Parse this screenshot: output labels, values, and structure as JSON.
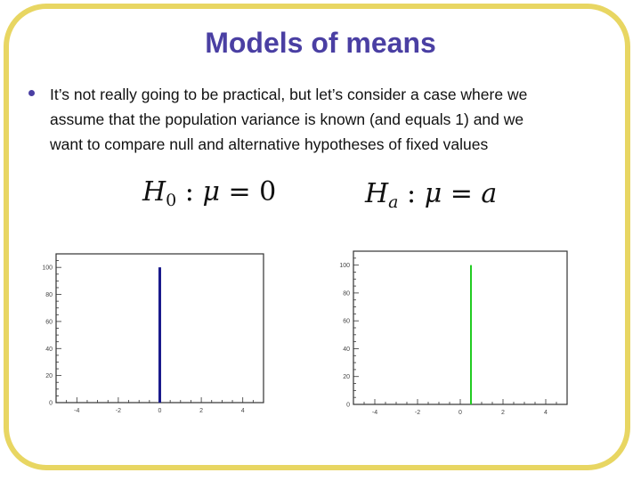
{
  "slide": {
    "title": "Models of means",
    "bullets": [
      {
        "lines": [
          "It’s not really going to be practical, but let’s consider a case where we",
          "assume that the population variance is known (and equals 1) and we",
          "want to compare null and alternative hypotheses of fixed values"
        ]
      }
    ],
    "formulas": {
      "null": {
        "H": "H",
        "sub": "0",
        "rest_mu": "μ",
        "colon": " : ",
        "equals": " = ",
        "value": "0"
      },
      "alt": {
        "H": "H",
        "sub": "a",
        "rest_mu": "μ",
        "colon": " : ",
        "equals": " = ",
        "value": "a"
      }
    },
    "colors": {
      "frame": "#e8d662",
      "title": "#4a3fa3",
      "null_line": "#1a1a8c",
      "alt_line": "#22cc22"
    }
  },
  "chart_data": [
    {
      "type": "bar",
      "name": "null-hypothesis-distribution",
      "title": "",
      "xlabel": "",
      "ylabel": "",
      "x": [
        0
      ],
      "values": [
        100
      ],
      "xlim": [
        -5,
        5
      ],
      "ylim": [
        0,
        110
      ],
      "xticks": [
        -4,
        -2,
        0,
        2,
        4
      ],
      "xtick_labels": [
        "-4",
        "-2",
        "0",
        "2",
        "4"
      ],
      "yticks": [
        0,
        20,
        40,
        60,
        80,
        100
      ],
      "ytick_labels": [
        "0",
        "20",
        "40",
        "60",
        "80",
        "100"
      ],
      "color": "#1a1a8c",
      "grid": false
    },
    {
      "type": "bar",
      "name": "alternative-hypothesis-distribution",
      "title": "",
      "xlabel": "",
      "ylabel": "",
      "x": [
        0.5
      ],
      "values": [
        100
      ],
      "xlim": [
        -5,
        5
      ],
      "ylim": [
        0,
        110
      ],
      "xticks": [
        -4,
        -2,
        0,
        2,
        4
      ],
      "xtick_labels": [
        "-4",
        "-2",
        "0",
        "2",
        "4"
      ],
      "yticks": [
        0,
        20,
        40,
        60,
        80,
        100
      ],
      "ytick_labels": [
        "0",
        "20",
        "40",
        "60",
        "80",
        "100"
      ],
      "color": "#22cc22",
      "grid": false
    }
  ]
}
